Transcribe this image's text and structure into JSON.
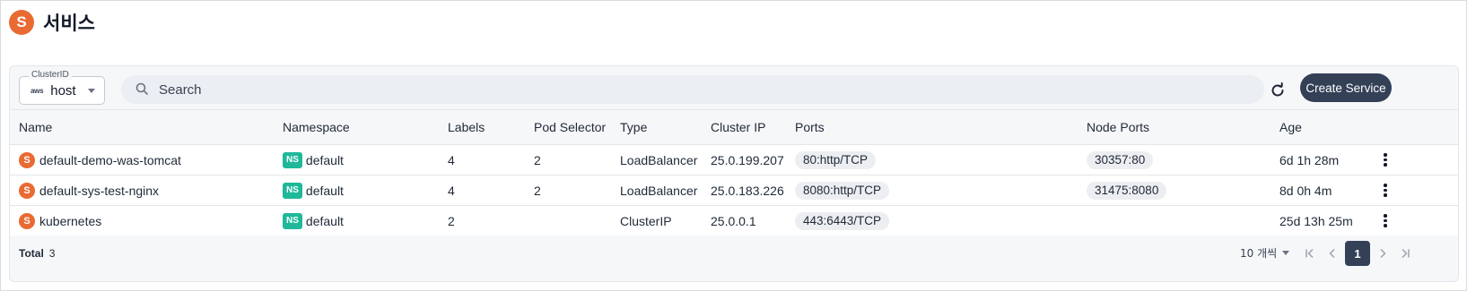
{
  "header": {
    "icon_letter": "S",
    "title": "서비스"
  },
  "toolbar": {
    "cluster_label": "ClusterID",
    "cluster_icon_text": "aws",
    "cluster_value": "host",
    "search_placeholder": "Search",
    "create_label": "Create Service"
  },
  "table": {
    "columns": [
      "Name",
      "Namespace",
      "Labels",
      "Pod Selector",
      "Type",
      "Cluster IP",
      "Ports",
      "Node Ports",
      "Age"
    ],
    "rows": [
      {
        "icon": "S",
        "name": "default-demo-was-tomcat",
        "ns_tag": "NS",
        "namespace": "default",
        "labels": "4",
        "pod_selector": "2",
        "type": "LoadBalancer",
        "cluster_ip": "25.0.199.207",
        "ports": "80:http/TCP",
        "node_ports": "30357:80",
        "age": "6d 1h 28m"
      },
      {
        "icon": "S",
        "name": "default-sys-test-nginx",
        "ns_tag": "NS",
        "namespace": "default",
        "labels": "4",
        "pod_selector": "2",
        "type": "LoadBalancer",
        "cluster_ip": "25.0.183.226",
        "ports": "8080:http/TCP",
        "node_ports": "31475:8080",
        "age": "8d 0h 4m"
      },
      {
        "icon": "S",
        "name": "kubernetes",
        "ns_tag": "NS",
        "namespace": "default",
        "labels": "2",
        "pod_selector": "",
        "type": "ClusterIP",
        "cluster_ip": "25.0.0.1",
        "ports": "443:6443/TCP",
        "node_ports": "",
        "age": "25d 13h 25m"
      }
    ]
  },
  "footer": {
    "total_label": "Total",
    "total_value": "3",
    "page_size": "10 개씩",
    "current_page": "1"
  }
}
